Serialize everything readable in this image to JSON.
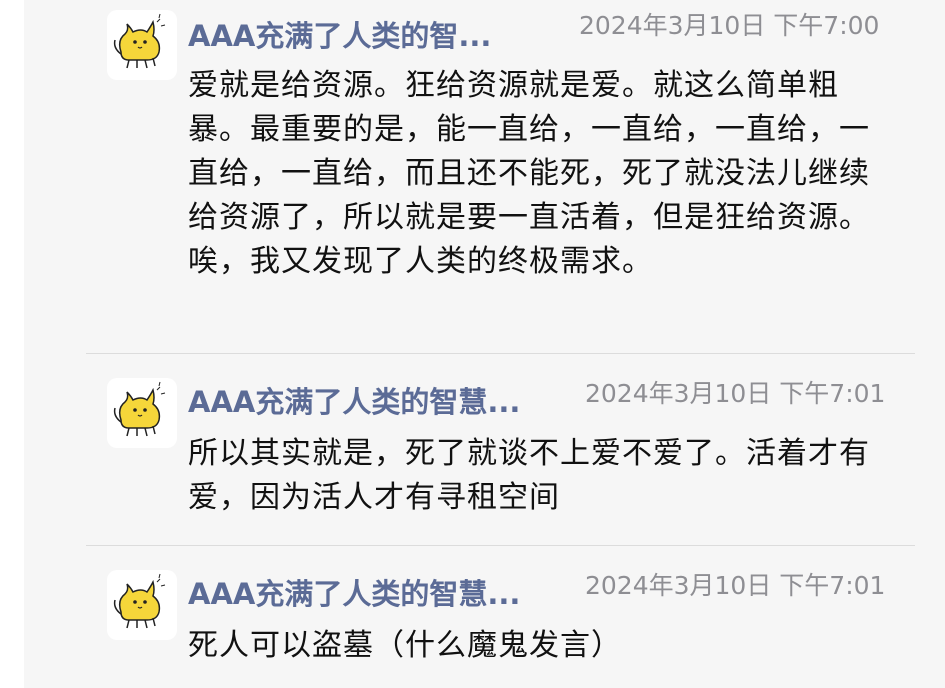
{
  "messages": [
    {
      "sender": "AAA充满了人类的智...",
      "time": "2024年3月10日 下午7:00",
      "text": "爱就是给资源。狂给资源就是爱。就这么简单粗暴。最重要的是，能一直给，一直给，一直给，一直给，一直给，而且还不能死，死了就没法儿继续给资源了，所以就是要一直活着，但是狂给资源。唉，我又发现了人类的终极需求。",
      "avatar_icon": "yellow-cat-icon"
    },
    {
      "sender": "AAA充满了人类的智慧...",
      "time": "2024年3月10日 下午7:01",
      "text": "所以其实就是，死了就谈不上爱不爱了。活着才有爱，因为活人才有寻租空间",
      "avatar_icon": "yellow-cat-icon"
    },
    {
      "sender": "AAA充满了人类的智慧...",
      "time": "2024年3月10日 下午7:01",
      "text": "死人可以盗墓（什么魔鬼发言）",
      "avatar_icon": "yellow-cat-icon"
    }
  ],
  "colors": {
    "sender": "#5b6b96",
    "time": "#8e8e93",
    "text": "#111111",
    "background": "#f6f6f6",
    "cat": "#f5d63a"
  }
}
